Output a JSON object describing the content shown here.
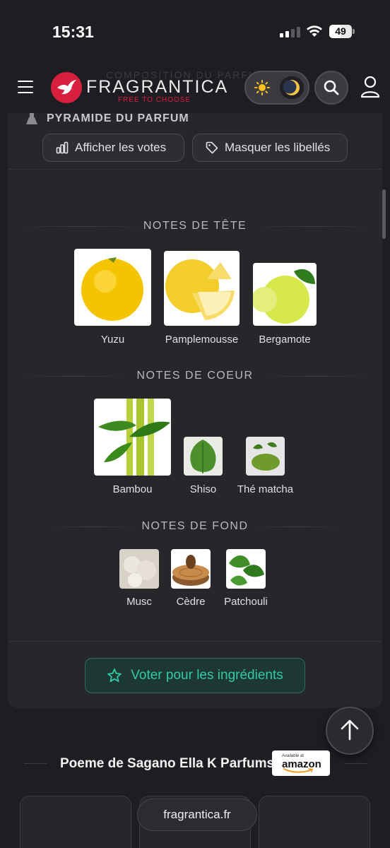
{
  "status_bar": {
    "time": "15:31",
    "battery": "49",
    "battery_level": 0.49
  },
  "header": {
    "ghost_title": "COMPOSITION DU PARFUM",
    "logo_text": "FRAGRANTICA",
    "logo_tagline": "FREE TO CHOOSE",
    "icons": [
      "menu-icon",
      "sun-icon",
      "moon-icon",
      "search-icon",
      "user-icon"
    ]
  },
  "pyramid": {
    "title": "PYRAMIDE DU PARFUM",
    "show_votes_label": "Afficher les votes",
    "hide_labels_label": "Masquer les libellés",
    "top": {
      "title": "NOTES DE TÊTE",
      "notes": [
        "Yuzu",
        "Pamplemousse",
        "Bergamote"
      ]
    },
    "heart": {
      "title": "NOTES DE COEUR",
      "notes": [
        "Bambou",
        "Shiso",
        "Thé matcha"
      ]
    },
    "base": {
      "title": "NOTES DE FOND",
      "notes": [
        "Musc",
        "Cèdre",
        "Patchouli"
      ]
    },
    "vote_label": "Voter pour les ingrédients"
  },
  "product": {
    "name": "Poeme de Sagano Ella K Parfums",
    "amazon_available": "Available at",
    "amazon_name": "amazon"
  },
  "browser": {
    "url": "fragrantica.fr"
  },
  "colors": {
    "brand": "#d81f3e",
    "accent": "#34c9a6",
    "background": "#1e1e22",
    "card": "#26262b"
  }
}
